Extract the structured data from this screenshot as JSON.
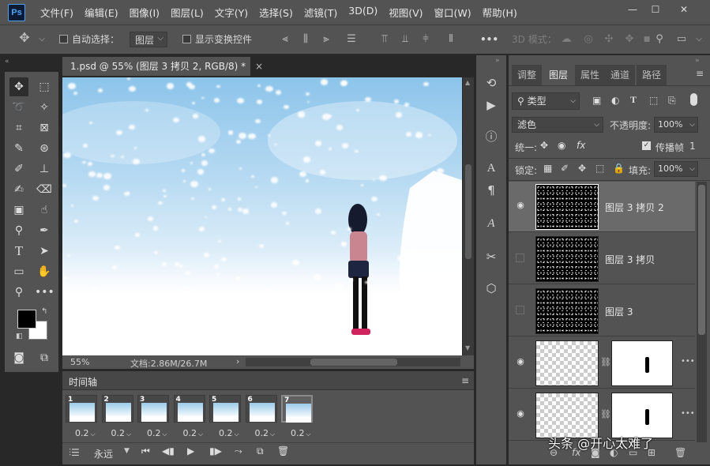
{
  "app": {
    "logo": "Ps"
  },
  "menu": [
    "文件(F)",
    "编辑(E)",
    "图像(I)",
    "图层(L)",
    "文字(Y)",
    "选择(S)",
    "滤镜(T)",
    "3D(D)",
    "视图(V)",
    "窗口(W)",
    "帮助(H)"
  ],
  "window_controls": {
    "minimize": "—",
    "restore": "☐",
    "close": "✕"
  },
  "options": {
    "auto_select_label": "自动选择：",
    "auto_select_value": "图层",
    "show_transform_label": "显示变换控件",
    "more": "•••",
    "mode_3d": "3D 模式："
  },
  "document": {
    "tab_title": "1.psd @ 55% (图层 3 拷贝 2, RGB/8) *",
    "close": "×",
    "zoom": "55%",
    "doc_size": "文档:2.86M/26.7M",
    "arrow": "›"
  },
  "timeline": {
    "title": "时间轴",
    "frames": [
      {
        "num": "1",
        "delay": "0.2"
      },
      {
        "num": "2",
        "delay": "0.2"
      },
      {
        "num": "3",
        "delay": "0.2"
      },
      {
        "num": "4",
        "delay": "0.2"
      },
      {
        "num": "5",
        "delay": "0.2"
      },
      {
        "num": "6",
        "delay": "0.2"
      },
      {
        "num": "7",
        "delay": "0.2"
      }
    ],
    "loop": "永远"
  },
  "layers_panel": {
    "tabs": [
      "调整",
      "图层",
      "属性",
      "通道",
      "路径"
    ],
    "active_tab": "图层",
    "filter_kind": "类型",
    "blend_mode": "滤色",
    "opacity_label": "不透明度:",
    "opacity_value": "100%",
    "unify_label": "统一:",
    "propagate_label": "传播帧",
    "propagate_value": "1",
    "lock_label": "锁定:",
    "fill_label": "填充:",
    "fill_value": "100%",
    "layers": [
      {
        "name": "图层 3 拷贝 2",
        "visible": true
      },
      {
        "name": "图层 3 拷贝",
        "visible": false
      },
      {
        "name": "图层 3",
        "visible": false
      },
      {
        "name": "",
        "visible": true
      },
      {
        "name": "",
        "visible": true
      }
    ]
  },
  "watermark": "头条 @开心太难了",
  "colors": {
    "ui_dark": "#535353",
    "bg": "#282828",
    "accent": "#4aa3ff"
  }
}
